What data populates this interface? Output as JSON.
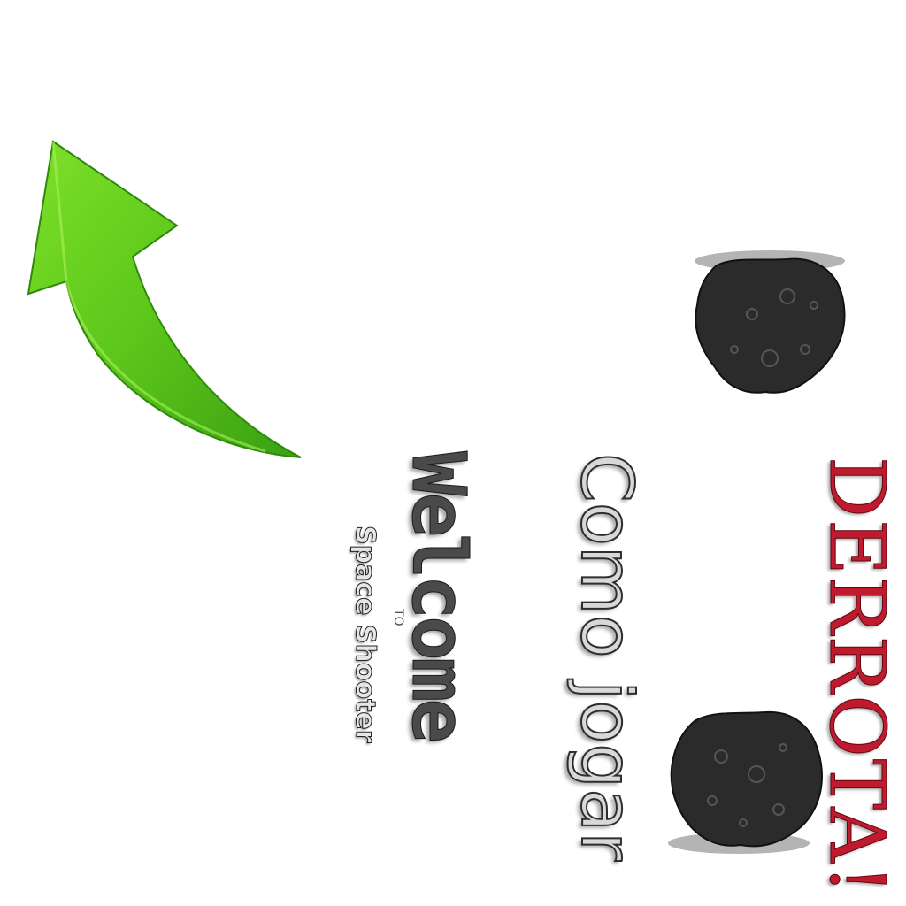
{
  "screen": {
    "defeat_text": "DERROTA!",
    "how_to_play_label": "Como jogar",
    "welcome_title": "Welcome",
    "welcome_to": "TO",
    "game_name": "Space Shooter"
  },
  "colors": {
    "background": "#ffffff",
    "defeat_red": "#c01a2e",
    "arrow_green": "#5cc61a",
    "asteroid_dark": "#2b2b2b"
  },
  "icons": [
    "green-arrow-icon",
    "asteroid-icon"
  ]
}
